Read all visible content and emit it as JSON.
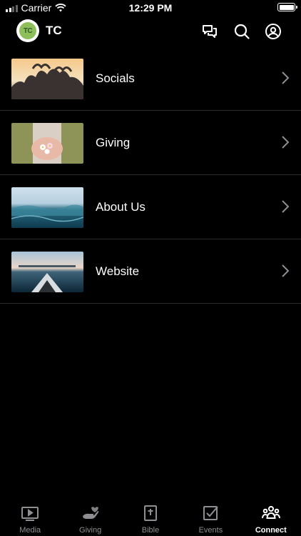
{
  "status_bar": {
    "carrier": "Carrier",
    "time": "12:29 PM"
  },
  "header": {
    "logo_text": "TC",
    "title": "TC"
  },
  "connect_items": [
    {
      "label": "Socials",
      "thumbnail": "sunset-friends-hearts"
    },
    {
      "label": "Giving",
      "thumbnail": "hands-holding-flowers"
    },
    {
      "label": "About Us",
      "thumbnail": "ocean-waves"
    },
    {
      "label": "Website",
      "thumbnail": "kayak-on-lake"
    }
  ],
  "tab_bar": {
    "active": "Connect",
    "tabs": [
      {
        "label": "Media",
        "icon": "play-icon"
      },
      {
        "label": "Giving",
        "icon": "giving-hand-icon"
      },
      {
        "label": "Bible",
        "icon": "bible-icon"
      },
      {
        "label": "Events",
        "icon": "checkbox-icon"
      },
      {
        "label": "Connect",
        "icon": "people-icon"
      }
    ]
  },
  "colors": {
    "background": "#000000",
    "text": "#ffffff",
    "inactive_tab": "#8e8e93",
    "separator": "#2c2c2e",
    "logo_green": "#8fbf5a"
  }
}
